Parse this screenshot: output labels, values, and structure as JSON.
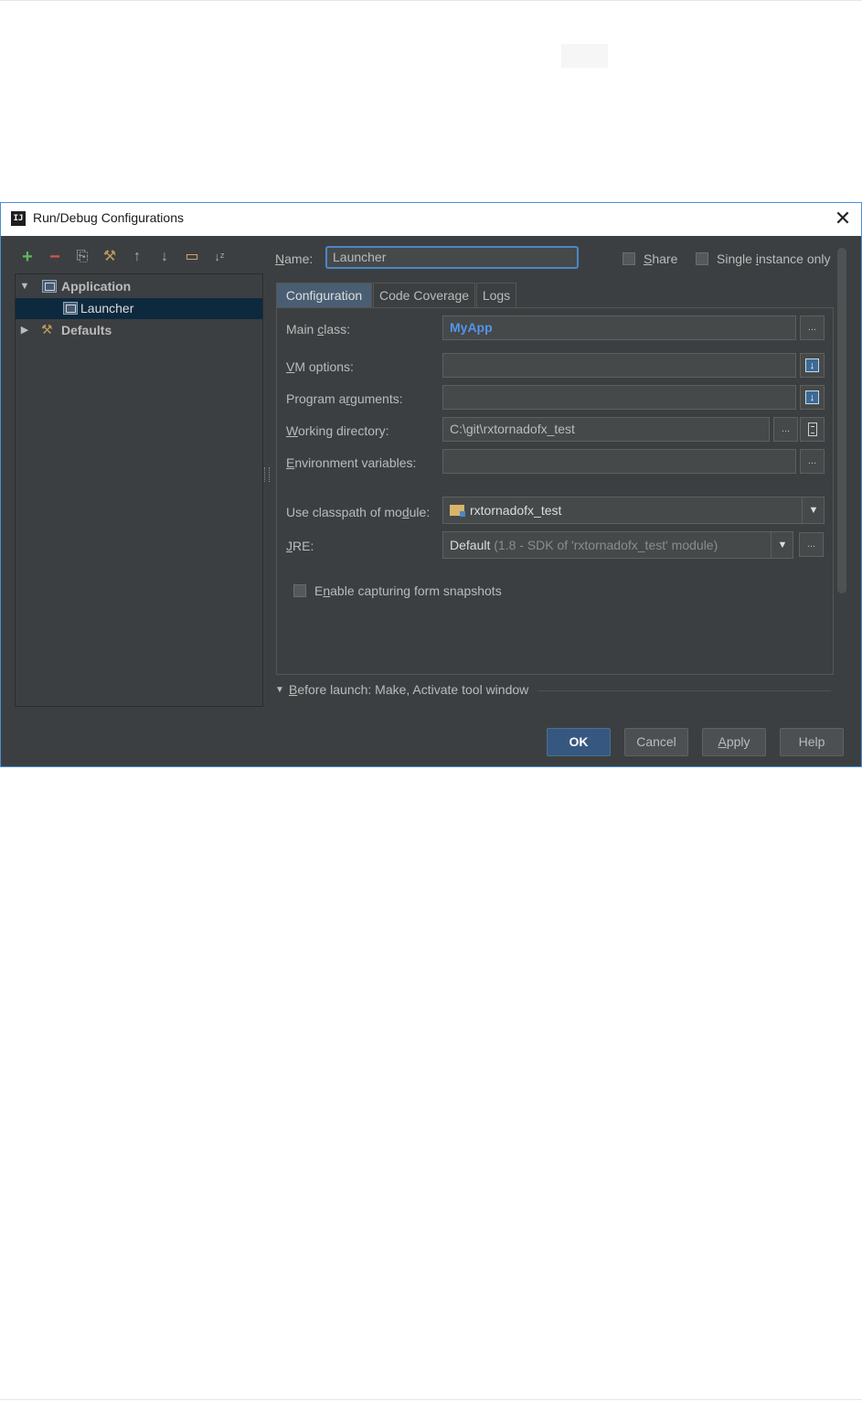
{
  "window": {
    "title": "Run/Debug Configurations",
    "close_glyph": "✕",
    "app_icon_text": "IJ"
  },
  "toolbar": {
    "add": "+",
    "remove": "−",
    "copy": "⎘",
    "edit_defaults": "⚒",
    "move_up": "↑",
    "move_down": "↓",
    "folder": "▭",
    "sort": "↓ᶻ"
  },
  "tree": {
    "application": {
      "label": "Application",
      "arrow": "▼"
    },
    "launcher": {
      "label": "Launcher"
    },
    "defaults": {
      "label": "Defaults",
      "arrow": "▶",
      "icon": "⚒"
    }
  },
  "header": {
    "name_label_u": "N",
    "name_label_rest": "ame:",
    "name_value": "Launcher",
    "share_u": "S",
    "share_rest": "hare",
    "single_pre": "Single ",
    "single_u": "i",
    "single_rest": "nstance only"
  },
  "tabs": [
    "Configuration",
    "Code Coverage",
    "Logs"
  ],
  "form": {
    "main_class_pre": "Main ",
    "main_class_u": "c",
    "main_class_rest": "lass:",
    "main_class_value": "MyApp",
    "vm_u": "V",
    "vm_rest": "M options:",
    "prog_pre": "Program a",
    "prog_u": "r",
    "prog_rest": "guments:",
    "wd_u": "W",
    "wd_rest": "orking directory:",
    "wd_value": "C:\\git\\rxtornadofx_test",
    "env_u": "E",
    "env_rest": "nvironment variables:",
    "cp_pre": "Use classpath of mo",
    "cp_u": "d",
    "cp_rest": "ule:",
    "cp_value": "rxtornadofx_test",
    "jre_u": "J",
    "jre_rest": "RE:",
    "jre_value": "Default",
    "jre_hint": "(1.8 - SDK of 'rxtornadofx_test' module)",
    "snap_pre": "E",
    "snap_u": "n",
    "snap_rest": "able capturing form snapshots",
    "ellipsis": "..."
  },
  "before_launch": {
    "arrow": "▼",
    "u": "B",
    "rest": "efore launch: Make, Activate tool window"
  },
  "buttons": {
    "ok": "OK",
    "cancel": "Cancel",
    "apply_u": "A",
    "apply_rest": "pply",
    "help": "Help"
  },
  "combo_arrow": "▼"
}
